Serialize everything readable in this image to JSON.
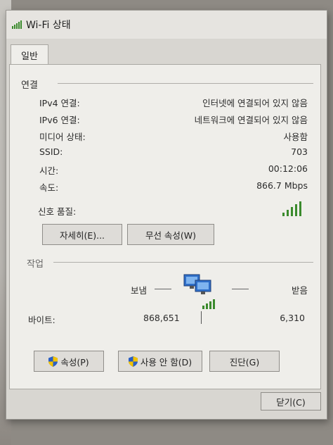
{
  "window": {
    "title": "Wi-Fi 상태"
  },
  "tabs": [
    {
      "label": "일반"
    }
  ],
  "connection": {
    "group_label": "연결",
    "rows": [
      {
        "label": "IPv4 연결:",
        "value": "인터넷에 연결되어 있지 않음"
      },
      {
        "label": "IPv6 연결:",
        "value": "네트워크에 연결되어 있지 않음"
      },
      {
        "label": "미디어 상태:",
        "value": "사용함"
      },
      {
        "label": "SSID:",
        "value": "703"
      },
      {
        "label": "시간:",
        "value": "00:12:06"
      },
      {
        "label": "속도:",
        "value": "866.7 Mbps"
      }
    ],
    "signal_label": "신호 품질:",
    "signal_bars_lit": 5,
    "signal_bars_total": 5,
    "details_button": "자세히(E)...",
    "wireless_button": "무선 속성(W)"
  },
  "activity": {
    "group_label": "작업",
    "sent_label": "보냄",
    "received_label": "받음",
    "bytes_label": "바이트:",
    "bytes_sent": "868,651",
    "bytes_received": "6,310"
  },
  "buttons": {
    "properties": "속성(P)",
    "disable": "사용 안 함(D)",
    "diagnose": "진단(G)",
    "close": "닫기(C)"
  },
  "colors": {
    "signal": "#3a8a2c",
    "shield_blue": "#2b5fc4",
    "shield_yellow": "#f2c200"
  }
}
